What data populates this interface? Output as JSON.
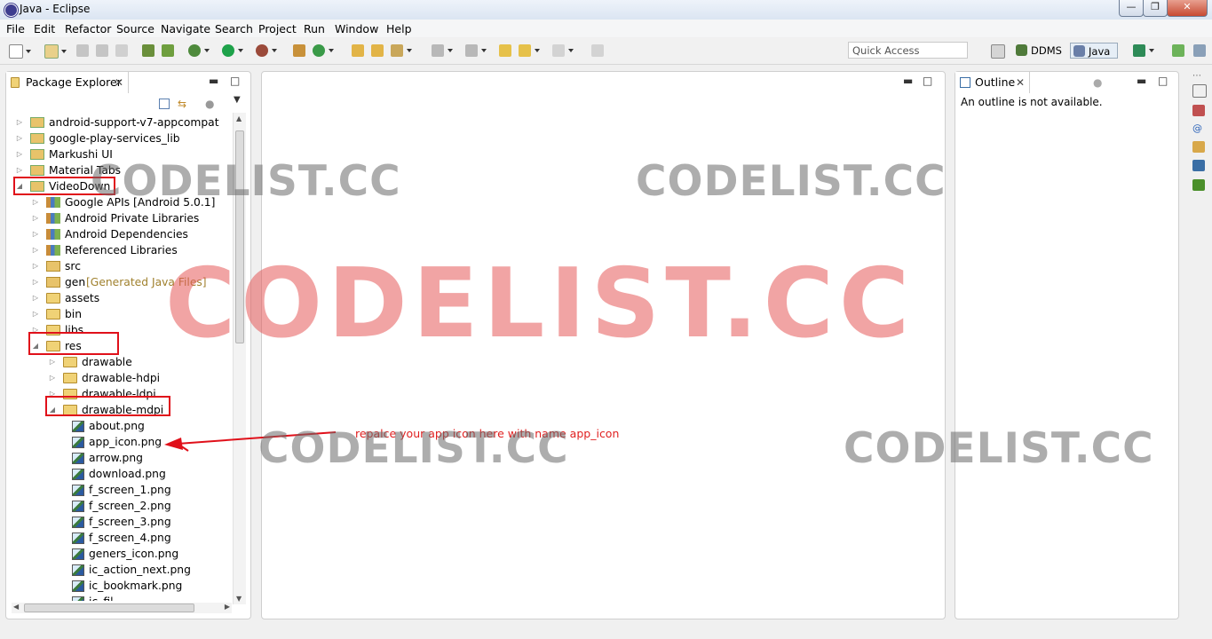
{
  "window": {
    "title": "Java - Eclipse"
  },
  "menu": [
    "File",
    "Edit",
    "Refactor",
    "Source",
    "Navigate",
    "Search",
    "Project",
    "Run",
    "Window",
    "Help"
  ],
  "toolbar": {
    "quick_access_placeholder": "Quick Access",
    "perspectives": [
      "DDMS",
      "Java"
    ]
  },
  "package_explorer": {
    "tab_label": "Package Explorer",
    "tree": [
      {
        "label": "android-support-v7-appcompat",
        "depth": 0,
        "icon": "project-icon",
        "expanded": false
      },
      {
        "label": "google-play-services_lib",
        "depth": 0,
        "icon": "project-icon",
        "expanded": false
      },
      {
        "label": "Markushi UI",
        "depth": 0,
        "icon": "project-icon",
        "expanded": false
      },
      {
        "label": "Material Tabs",
        "depth": 0,
        "icon": "project-icon",
        "expanded": false
      },
      {
        "label": "VideoDown",
        "depth": 0,
        "icon": "project-icon",
        "expanded": true
      },
      {
        "label": "Google APIs [Android 5.0.1]",
        "depth": 1,
        "icon": "library-icon",
        "expanded": false
      },
      {
        "label": "Android Private Libraries",
        "depth": 1,
        "icon": "library-icon",
        "expanded": false
      },
      {
        "label": "Android Dependencies",
        "depth": 1,
        "icon": "library-icon",
        "expanded": false
      },
      {
        "label": "Referenced Libraries",
        "depth": 1,
        "icon": "library-icon",
        "expanded": false
      },
      {
        "label": "src",
        "depth": 1,
        "icon": "package-icon",
        "expanded": false
      },
      {
        "label": "gen",
        "decoration": "[Generated Java Files]",
        "depth": 1,
        "icon": "package-icon",
        "expanded": false
      },
      {
        "label": "assets",
        "depth": 1,
        "icon": "folder-icon",
        "expanded": false
      },
      {
        "label": "bin",
        "depth": 1,
        "icon": "folder-icon",
        "expanded": false
      },
      {
        "label": "libs",
        "depth": 1,
        "icon": "folder-icon",
        "expanded": false
      },
      {
        "label": "res",
        "depth": 1,
        "icon": "folder-icon",
        "expanded": true
      },
      {
        "label": "drawable",
        "depth": 2,
        "icon": "folder-icon",
        "expanded": false
      },
      {
        "label": "drawable-hdpi",
        "depth": 2,
        "icon": "folder-icon",
        "expanded": false
      },
      {
        "label": "drawable-ldpi",
        "depth": 2,
        "icon": "folder-icon",
        "expanded": false
      },
      {
        "label": "drawable-mdpi",
        "depth": 2,
        "icon": "folder-icon",
        "expanded": true
      },
      {
        "label": "about.png",
        "depth": 3,
        "icon": "image-file-icon",
        "leaf": true
      },
      {
        "label": "app_icon.png",
        "depth": 3,
        "icon": "image-file-icon",
        "leaf": true
      },
      {
        "label": "arrow.png",
        "depth": 3,
        "icon": "image-file-icon",
        "leaf": true
      },
      {
        "label": "download.png",
        "depth": 3,
        "icon": "image-file-icon",
        "leaf": true
      },
      {
        "label": "f_screen_1.png",
        "depth": 3,
        "icon": "image-file-icon",
        "leaf": true
      },
      {
        "label": "f_screen_2.png",
        "depth": 3,
        "icon": "image-file-icon",
        "leaf": true
      },
      {
        "label": "f_screen_3.png",
        "depth": 3,
        "icon": "image-file-icon",
        "leaf": true
      },
      {
        "label": "f_screen_4.png",
        "depth": 3,
        "icon": "image-file-icon",
        "leaf": true
      },
      {
        "label": "geners_icon.png",
        "depth": 3,
        "icon": "image-file-icon",
        "leaf": true
      },
      {
        "label": "ic_action_next.png",
        "depth": 3,
        "icon": "image-file-icon",
        "leaf": true
      },
      {
        "label": "ic_bookmark.png",
        "depth": 3,
        "icon": "image-file-icon",
        "leaf": true
      },
      {
        "label": "ic_fil",
        "depth": 3,
        "icon": "image-file-icon",
        "leaf": true
      }
    ]
  },
  "outline": {
    "tab_label": "Outline",
    "message": "An outline is not available."
  },
  "annotation": {
    "text": "repalce your app icon here with name app_icon",
    "color": "#e02020"
  },
  "watermark": {
    "text": "CODELIST.CC"
  },
  "colors": {
    "annotation_red": "#e0101a",
    "watermark_red": "#e65a5a"
  }
}
